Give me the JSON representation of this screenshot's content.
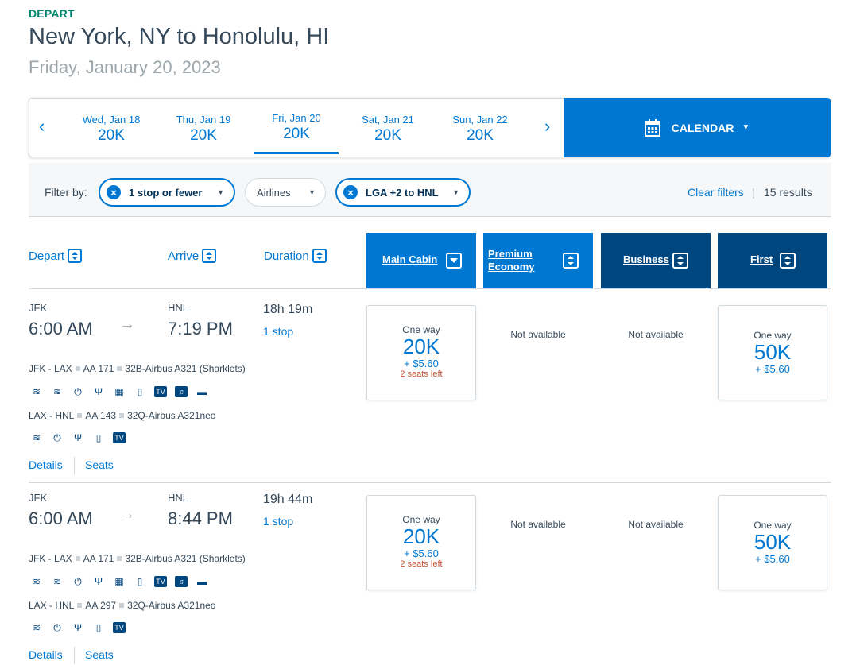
{
  "header": {
    "tag": "DEPART",
    "title": "New York, NY to Honolulu, HI",
    "subtitle": "Friday, January 20, 2023"
  },
  "date_strip": {
    "prev": "‹",
    "next": "›",
    "dates": [
      {
        "day": "Wed, Jan 18",
        "price": "20K"
      },
      {
        "day": "Thu, Jan 19",
        "price": "20K"
      },
      {
        "day": "Fri, Jan 20",
        "price": "20K"
      },
      {
        "day": "Sat, Jan 21",
        "price": "20K"
      },
      {
        "day": "Sun, Jan 22",
        "price": "20K"
      }
    ],
    "selected_index": 2,
    "calendar_label": "CALENDAR"
  },
  "filters": {
    "label": "Filter by:",
    "chips": [
      {
        "label": "1 stop or fewer",
        "active": true
      },
      {
        "label": "Airlines",
        "active": false
      },
      {
        "label": "LGA +2 to HNL",
        "active": true
      }
    ],
    "clear": "Clear filters",
    "separator": "|",
    "results": "15 results"
  },
  "columns": {
    "depart": "Depart",
    "arrive": "Arrive",
    "duration": "Duration",
    "main_cabin": "Main Cabin",
    "premium_l1": "Premium",
    "premium_l2": "Economy",
    "business": "Business",
    "first": "First"
  },
  "flights": [
    {
      "from": "JFK",
      "to": "HNL",
      "depart_time": "6:00 AM",
      "arrive_time": "7:19 PM",
      "duration": "18h 19m",
      "stops": "1 stop",
      "seg1": {
        "route": "JFK - LAX",
        "flight": "AA 171",
        "aircraft": "32B-Airbus A321 (Sharklets)"
      },
      "seg2": {
        "route": "LAX - HNL",
        "flight": "AA 143",
        "aircraft": "32Q-Airbus A321neo"
      },
      "main": {
        "label": "One way",
        "miles": "20K",
        "tax": "+ $5.60",
        "seats": "2 seats left"
      },
      "premium": "Not available",
      "business": "Not available",
      "first": {
        "label": "One way",
        "miles": "50K",
        "tax": "+ $5.60"
      },
      "details": "Details",
      "seats_link": "Seats"
    },
    {
      "from": "JFK",
      "to": "HNL",
      "depart_time": "6:00 AM",
      "arrive_time": "8:44 PM",
      "duration": "19h 44m",
      "stops": "1 stop",
      "seg1": {
        "route": "JFK - LAX",
        "flight": "AA 171",
        "aircraft": "32B-Airbus A321 (Sharklets)"
      },
      "seg2": {
        "route": "LAX - HNL",
        "flight": "AA 297",
        "aircraft": "32Q-Airbus A321neo"
      },
      "main": {
        "label": "One way",
        "miles": "20K",
        "tax": "+ $5.60",
        "seats": "2 seats left"
      },
      "premium": "Not available",
      "business": "Not available",
      "first": {
        "label": "One way",
        "miles": "50K",
        "tax": "+ $5.60"
      },
      "details": "Details",
      "seats_link": "Seats"
    }
  ],
  "amenity_icons": {
    "seg1": [
      "wifi-icon",
      "wifi-icon",
      "power-icon",
      "usb-icon",
      "entertainment-icon",
      "phone-icon",
      "tv-icon",
      "music-icon",
      "seat-icon"
    ],
    "seg2": [
      "wifi-icon",
      "power-icon",
      "usb-icon",
      "phone-icon",
      "tv-icon"
    ]
  },
  "colors": {
    "accent": "#0078d2",
    "dark_navy": "#00467f",
    "green_tag": "#00856f",
    "seats_warning": "#c8502a"
  }
}
